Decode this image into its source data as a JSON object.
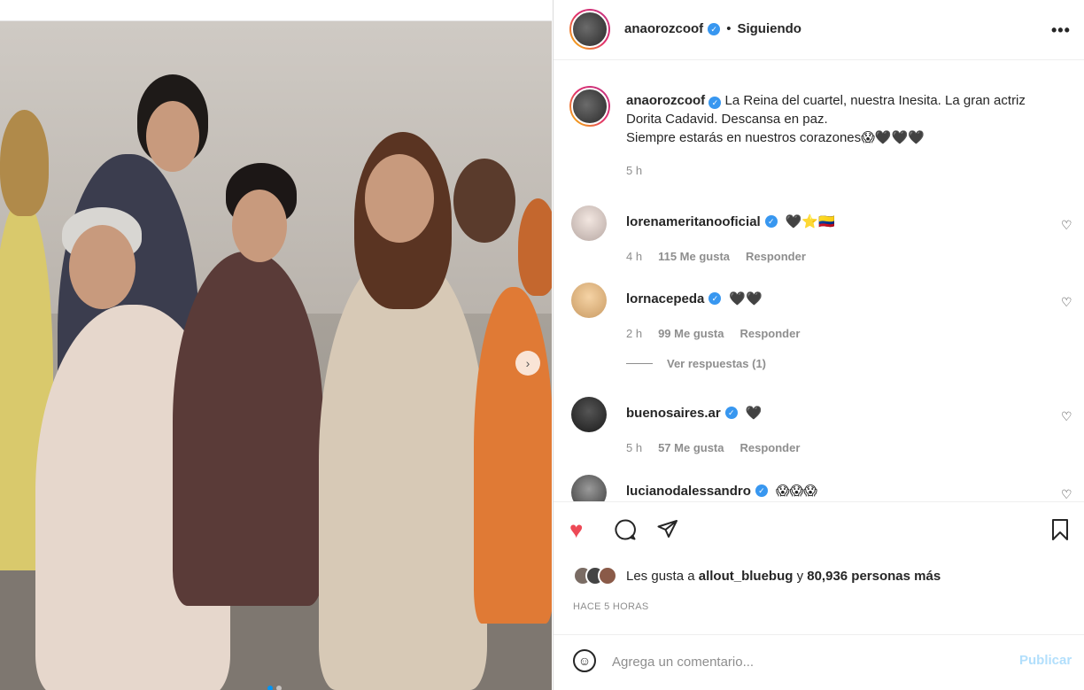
{
  "post": {
    "author": "anaorozcoof",
    "follow_state": "Siguiendo",
    "separator": "•",
    "more_icon": "•••",
    "caption_lines": [
      "La Reina del cuartel, nuestra Inesita. La gran actriz",
      "Dorita Cadavid. Descansa en paz.",
      "Siempre estarás en nuestros corazones😱🖤🖤🖤"
    ],
    "caption_time": "5 h"
  },
  "comments": [
    {
      "user": "lorenameritanooficial",
      "text": "🖤⭐️🇨🇴",
      "time": "4 h",
      "likes": "115 Me gusta",
      "reply": "Responder"
    },
    {
      "user": "lornacepeda",
      "text": "🖤🖤",
      "time": "2 h",
      "likes": "99 Me gusta",
      "reply": "Responder"
    },
    {
      "user": "buenosaires.ar",
      "text": "🖤",
      "time": "5 h",
      "likes": "57 Me gusta",
      "reply": "Responder"
    },
    {
      "user": "lucianodalessandro",
      "text": "😱😱😱",
      "time": "",
      "likes": "",
      "reply": ""
    }
  ],
  "view_replies": "Ver respuestas (1)",
  "likes_line": {
    "prefix": "Les gusta a",
    "user": "allout_bluebug",
    "connector": "y",
    "count": "80,936 personas más"
  },
  "posted_ago": "HACE 5 HORAS",
  "add_comment": {
    "placeholder": "Agrega un comentario...",
    "publish_label": "Publicar"
  },
  "carousel": {
    "current": 1,
    "total": 2
  },
  "colors": {
    "like": "#ed4956",
    "verified": "#3897f0",
    "publish_disabled": "#b2dffc"
  },
  "icons": [
    "heart-icon",
    "comment-icon",
    "share-icon",
    "bookmark-icon",
    "emoji-icon",
    "chevron-right-icon",
    "verified-icon",
    "more-icon"
  ]
}
